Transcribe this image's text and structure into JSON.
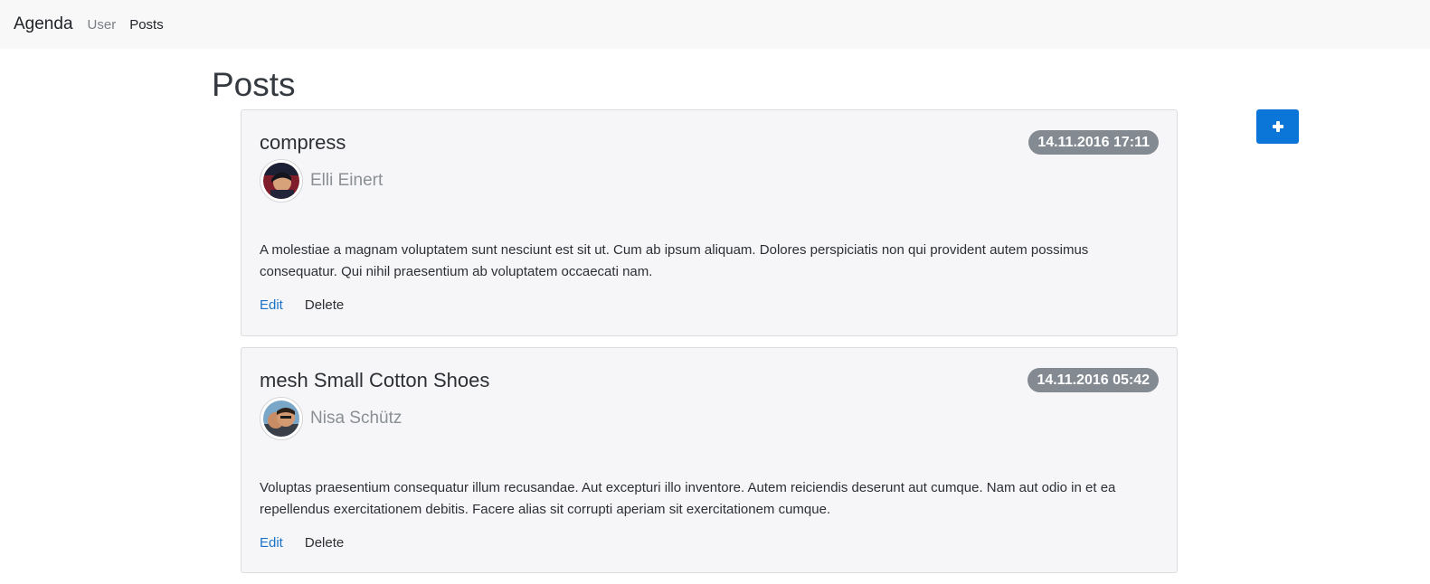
{
  "nav": {
    "brand": "Agenda",
    "links": [
      {
        "label": "User"
      },
      {
        "label": "Posts"
      }
    ]
  },
  "page": {
    "title": "Posts",
    "add_button_icon": "plus-icon"
  },
  "posts": [
    {
      "title": "compress",
      "date": "14.11.2016 17:11",
      "author": "Elli Einert",
      "body": "A molestiae a magnam voluptatem sunt nesciunt est sit ut. Cum ab ipsum aliquam. Dolores perspiciatis non qui provident autem possimus consequatur. Qui nihil praesentium ab voluptatem occaecati nam.",
      "edit_label": "Edit",
      "delete_label": "Delete"
    },
    {
      "title": "mesh Small Cotton Shoes",
      "date": "14.11.2016 05:42",
      "author": "Nisa Schütz",
      "body": "Voluptas praesentium consequatur illum recusandae. Aut excepturi illo inventore. Autem reiciendis deserunt aut cumque. Nam aut odio in et ea repellendus exercitationem debitis. Facere alias sit corrupti aperiam sit exercitationem cumque.",
      "edit_label": "Edit",
      "delete_label": "Delete"
    }
  ],
  "colors": {
    "primary": "#0c75d8",
    "badge": "#848a92",
    "link": "#1a73c9",
    "navbar_bg": "#f8f8f9",
    "card_bg": "#f6f6f8"
  }
}
